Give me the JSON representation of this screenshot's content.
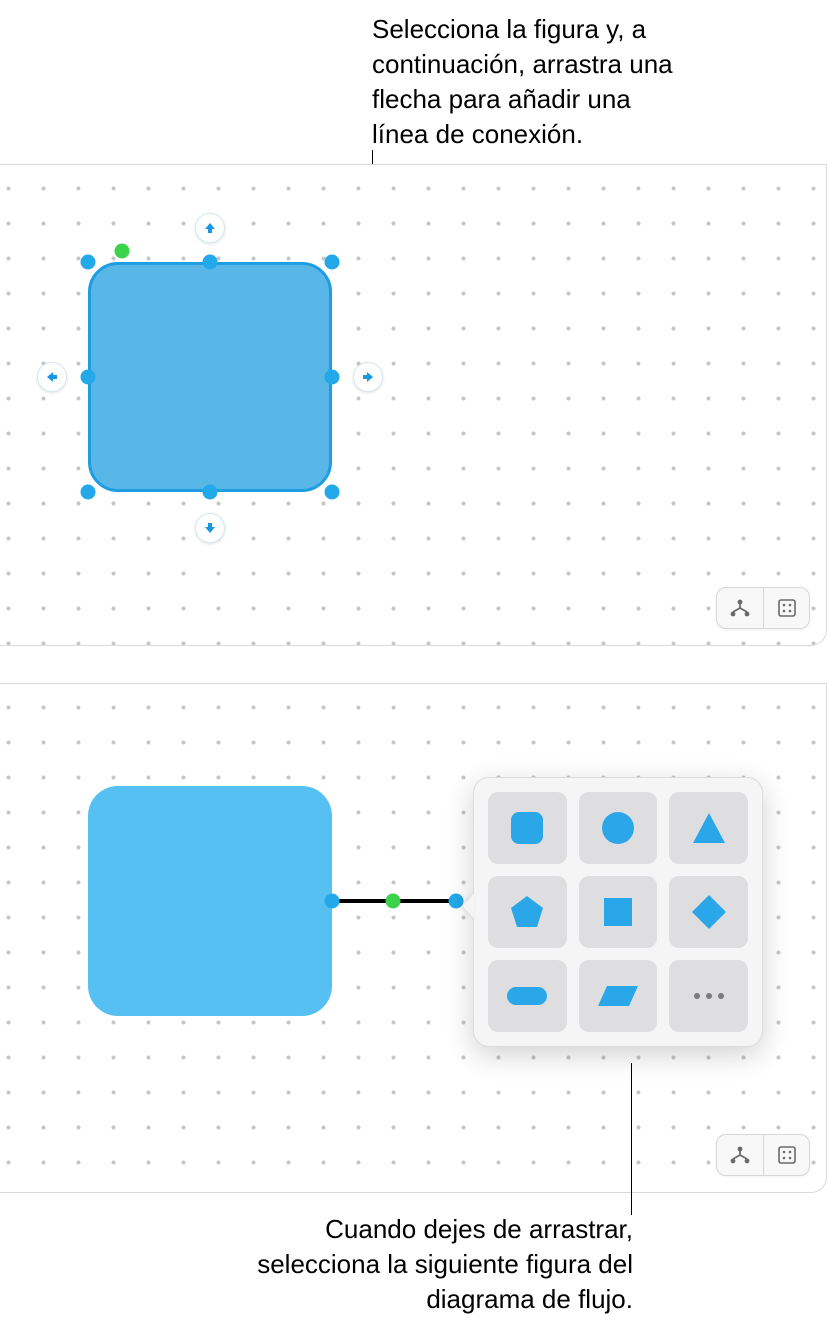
{
  "callouts": {
    "top": "Selecciona la figura y, a continuación, arrastra una flecha para añadir una línea de conexión.",
    "bottom": "Cuando dejes de arrastrar, selecciona la siguiente figura del diagrama de flujo."
  },
  "shapes": {
    "selected_shape": "rounded-square",
    "fill_color": "#57c0f2",
    "selection_color": "#23a8ea"
  },
  "directional_arrows": [
    "up",
    "down",
    "left",
    "right"
  ],
  "toolbar": {
    "connector_mode": "connector-icon",
    "grid_mode": "grid-icon"
  },
  "shape_picker": {
    "options": [
      "rounded-square",
      "circle",
      "triangle",
      "pentagon",
      "square",
      "diamond",
      "pill",
      "parallelogram",
      "more"
    ]
  }
}
